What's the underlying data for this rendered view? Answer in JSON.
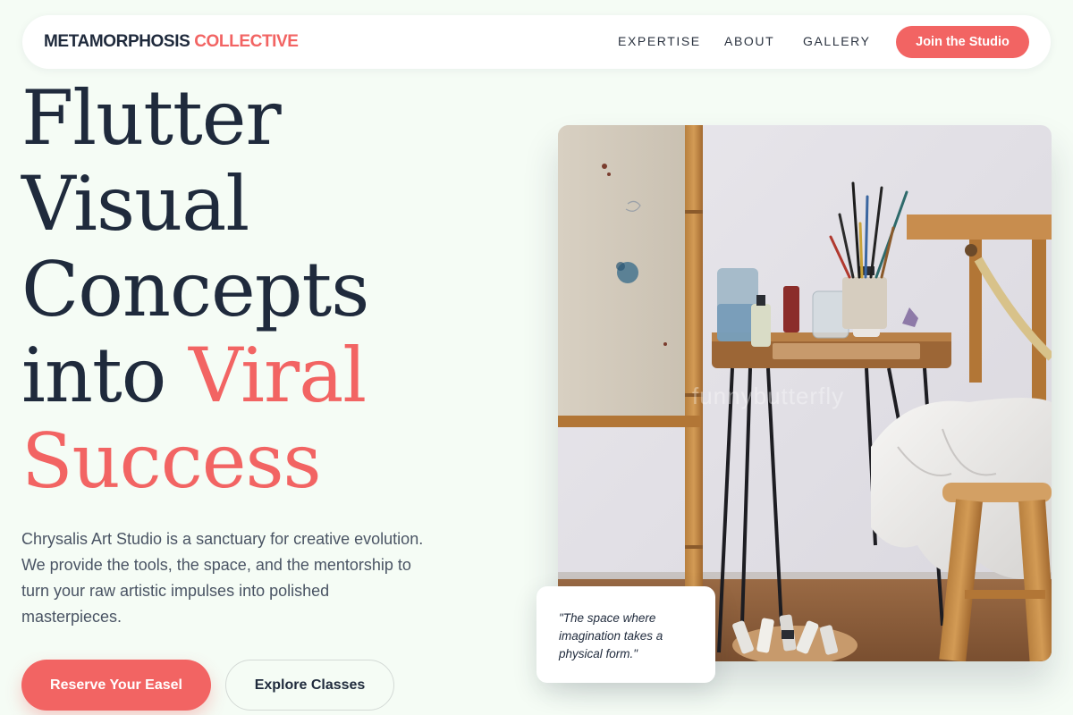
{
  "nav": {
    "logo_main": "METAMORPHOSIS",
    "logo_accent": "COLLECTIVE",
    "links": [
      "EXPERTISE",
      "ABOUT",
      "GALLERY"
    ],
    "cta": "Join the Studio"
  },
  "hero": {
    "headline_lines": [
      "Flutter",
      "Visual",
      "Concepts"
    ],
    "headline_into": "into",
    "headline_accent_1": "Viral",
    "headline_accent_2": "Success",
    "description": "Chrysalis Art Studio is a sanctuary for creative evolution. We provide the tools, the space, and the mentorship to turn your raw artistic impulses into polished masterpieces.",
    "primary_button": "Reserve Your Easel",
    "secondary_button": "Explore Classes"
  },
  "image": {
    "watermark": "funnybutterfly"
  },
  "quote": {
    "text": "\"The space where imagination takes a physical form.\""
  },
  "colors": {
    "accent": "#f26463",
    "ink": "#1f2a3c",
    "background": "#f5fcf5"
  }
}
